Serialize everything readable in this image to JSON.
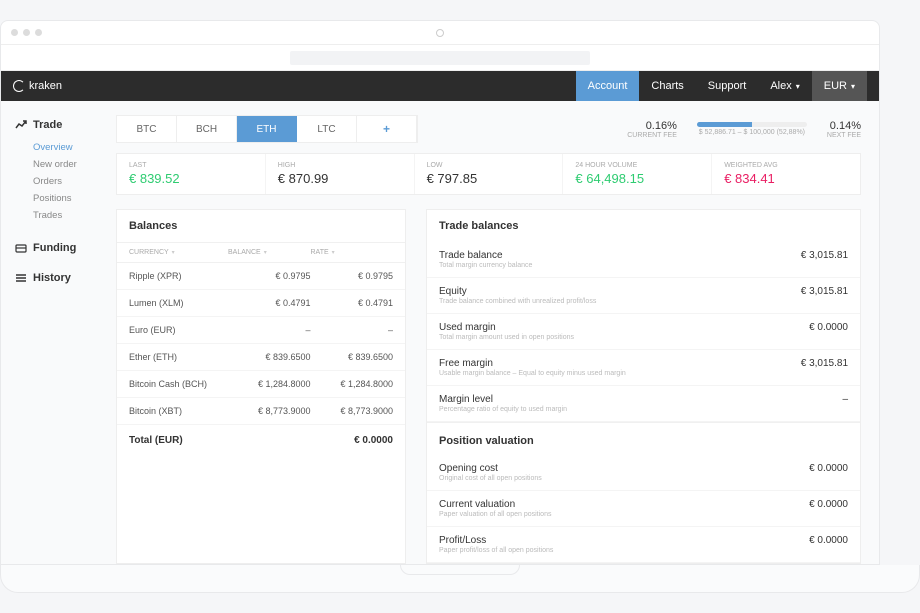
{
  "brand": "kraken",
  "topnav": {
    "account": "Account",
    "charts": "Charts",
    "support": "Support",
    "user": "Alex",
    "currency": "EUR"
  },
  "sidebar": {
    "trade": {
      "label": "Trade",
      "items": [
        "Overview",
        "New order",
        "Orders",
        "Positions",
        "Trades"
      ],
      "active": 0
    },
    "funding": {
      "label": "Funding"
    },
    "history": {
      "label": "History"
    }
  },
  "tabs": [
    "BTC",
    "BCH",
    "ETH",
    "LTC"
  ],
  "active_tab": 2,
  "fee": {
    "current_val": "0.16%",
    "current_lbl": "CURRENT FEE",
    "progress_text": "$ 52,886.71 – $ 100,000 (52,88%)",
    "next_val": "0.14%",
    "next_lbl": "NEXT FEE"
  },
  "stats": [
    {
      "lbl": "LAST",
      "val": "€ 839.52",
      "cls": "green"
    },
    {
      "lbl": "HIGH",
      "val": "€ 870.99",
      "cls": "dark"
    },
    {
      "lbl": "LOW",
      "val": "€ 797.85",
      "cls": "dark"
    },
    {
      "lbl": "24 HOUR VOLUME",
      "val": "€ 64,498.15",
      "cls": "green"
    },
    {
      "lbl": "WEIGHTED AVG",
      "val": "€ 834.41",
      "cls": "pink"
    }
  ],
  "balances": {
    "title": "Balances",
    "head": [
      "CURRENCY",
      "BALANCE",
      "RATE"
    ],
    "rows": [
      [
        "Ripple (XPR)",
        "€ 0.9795",
        "€ 0.9795"
      ],
      [
        "Lumen (XLM)",
        "€ 0.4791",
        "€ 0.4791"
      ],
      [
        "Euro (EUR)",
        "–",
        "–"
      ],
      [
        "Ether (ETH)",
        "€ 839.6500",
        "€ 839.6500"
      ],
      [
        "Bitcoin Cash (BCH)",
        "€ 1,284.8000",
        "€ 1,284.8000"
      ],
      [
        "Bitcoin (XBT)",
        "€ 8,773.9000",
        "€ 8,773.9000"
      ]
    ],
    "total_lbl": "Total (EUR)",
    "total_val": "€ 0.0000"
  },
  "trade_balances": {
    "title": "Trade balances",
    "rows": [
      {
        "label": "Trade balance",
        "desc": "Total margin currency balance",
        "val": "€ 3,015.81"
      },
      {
        "label": "Equity",
        "desc": "Trade balance combined with unrealized profit/loss",
        "val": "€ 3,015.81"
      },
      {
        "label": "Used margin",
        "desc": "Total margin amount used in open positions",
        "val": "€ 0.0000"
      },
      {
        "label": "Free margin",
        "desc": "Usable margin balance – Equal to equity minus used margin",
        "val": "€ 3,015.81"
      },
      {
        "label": "Margin level",
        "desc": "Percentage ratio of equity to used margin",
        "val": "–"
      }
    ]
  },
  "position_valuation": {
    "title": "Position valuation",
    "rows": [
      {
        "label": "Opening cost",
        "desc": "Original cost of all open positions",
        "val": "€ 0.0000"
      },
      {
        "label": "Current valuation",
        "desc": "Paper valuation of all open positions",
        "val": "€ 0.0000"
      },
      {
        "label": "Profit/Loss",
        "desc": "Paper profit/loss of all open positions",
        "val": "€ 0.0000"
      }
    ]
  }
}
